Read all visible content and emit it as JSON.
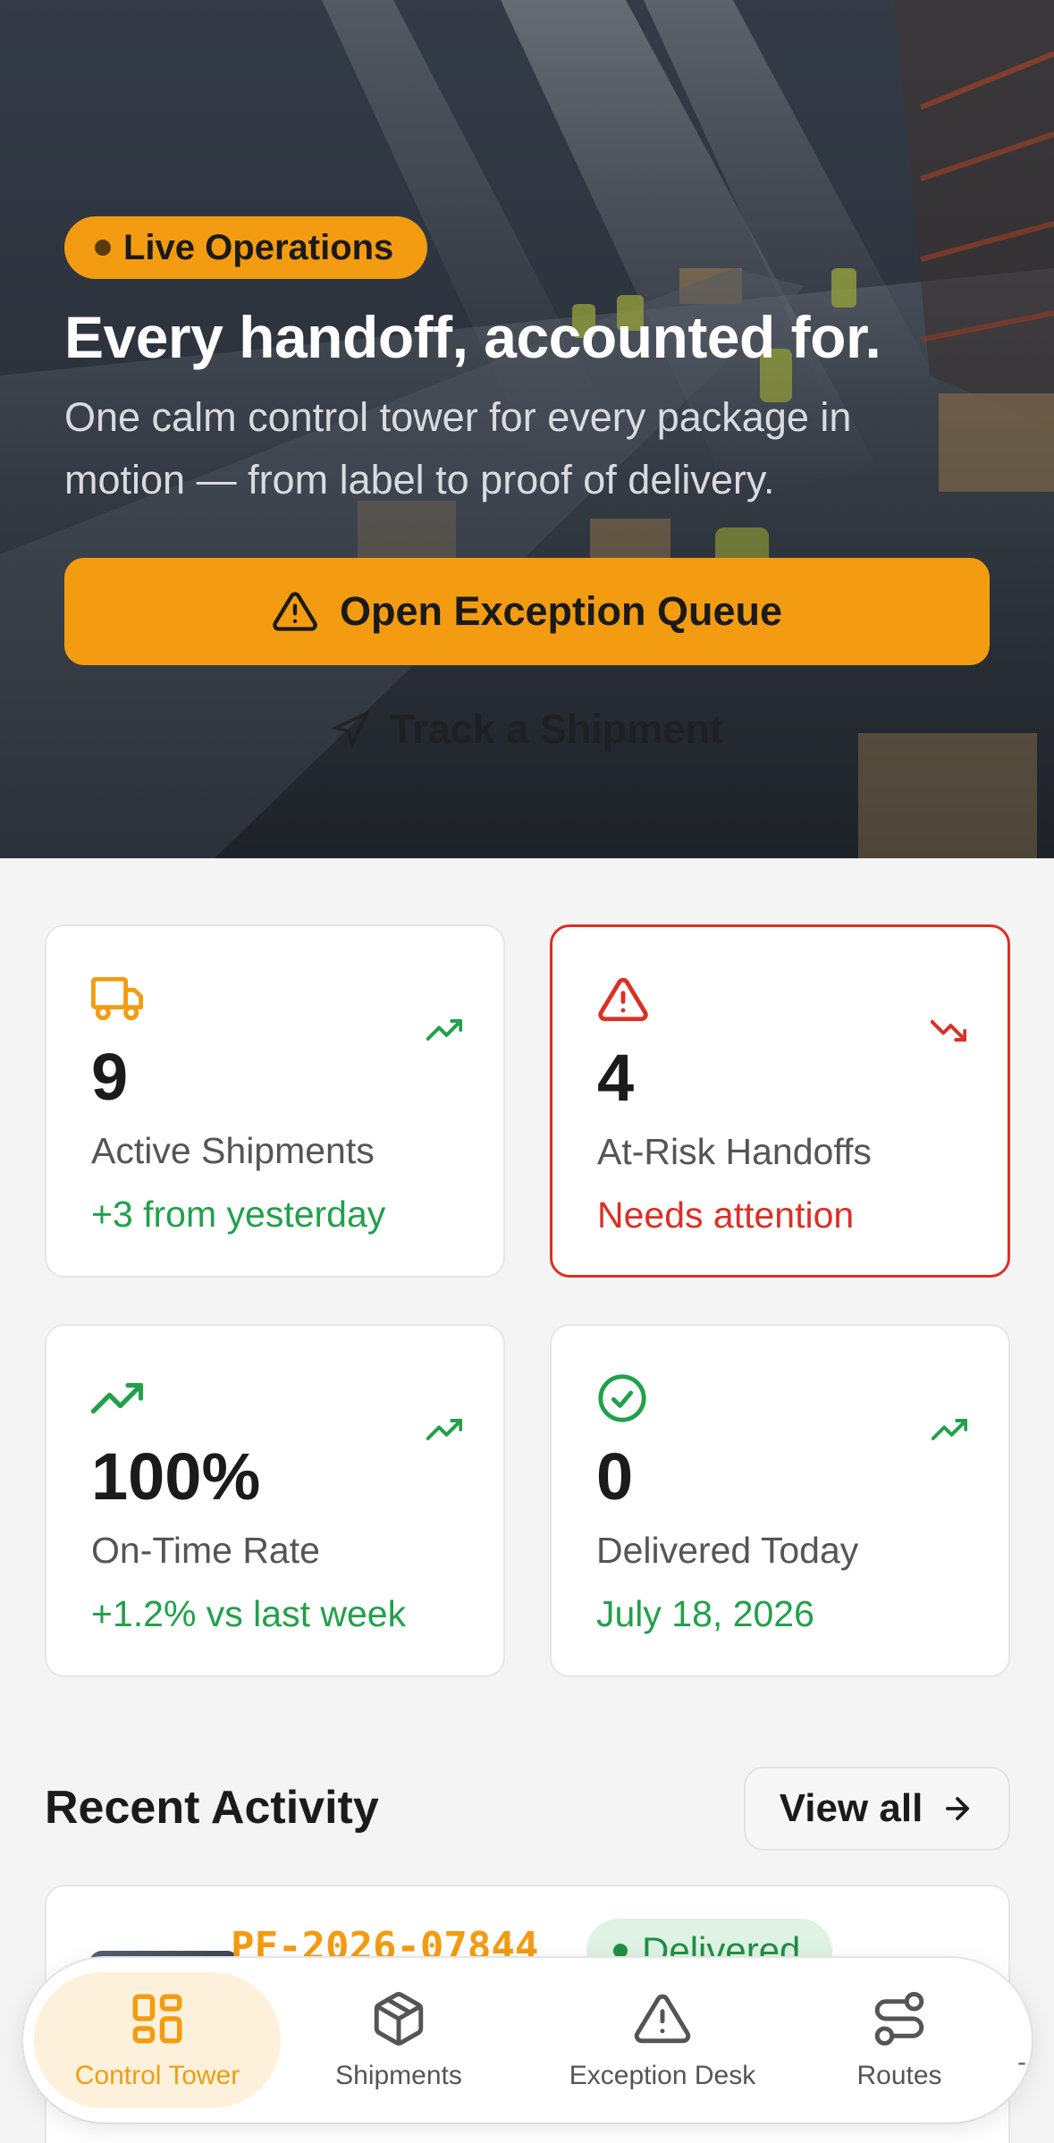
{
  "hero": {
    "badge": "Live Operations",
    "title": "Every handoff, accounted for.",
    "subtitle": "One calm control tower for every package in motion — from label to proof of delivery.",
    "cta_label": "Open Exception Queue",
    "track_label": "Track a Shipment"
  },
  "stats": [
    {
      "icon": "truck-icon",
      "trend": "trending-up-icon",
      "value": "9",
      "label": "Active Shipments",
      "note": "+3 from yesterday",
      "note_color": "#22a04b"
    },
    {
      "icon": "alert-triangle-icon",
      "trend": "trending-down-icon",
      "value": "4",
      "label": "At-Risk Handoffs",
      "note": "Needs attention",
      "note_color": "#d93025"
    },
    {
      "icon": "trending-up-icon",
      "trend": "trending-up-icon",
      "value": "100%",
      "label": "On-Time Rate",
      "note": "+1.2% vs last week",
      "note_color": "#22a04b"
    },
    {
      "icon": "check-circle-icon",
      "trend": "trending-up-icon",
      "value": "0",
      "label": "Delivered Today",
      "note": "July 18, 2026",
      "note_color": "#22a04b"
    }
  ],
  "activity": {
    "title": "Recent Activity",
    "view_all": "View all",
    "items": [
      {
        "id": "PF-2026-07844",
        "status": "Delivered"
      }
    ]
  },
  "nav": {
    "items": [
      {
        "label": "Control Tower",
        "icon": "grid-icon",
        "active": true
      },
      {
        "label": "Shipments",
        "icon": "package-icon",
        "active": false
      },
      {
        "label": "Exception Desk",
        "icon": "alert-triangle-icon",
        "active": false
      },
      {
        "label": "Routes",
        "icon": "route-icon",
        "active": false
      }
    ]
  },
  "colors": {
    "accent": "#f39c12",
    "success": "#22a04b",
    "danger": "#d93025"
  }
}
